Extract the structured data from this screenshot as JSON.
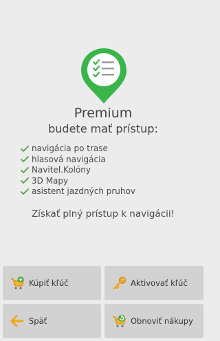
{
  "header": {
    "title": "Premium",
    "subtitle": "budete mať prístup:"
  },
  "features": [
    "navigácia po trase",
    "hlasová navigácia",
    "Navitel.Kolóny",
    "3D Mapy",
    "asistent jazdných pruhov"
  ],
  "cta_text": "Získať plný prístup k navigácii!",
  "buttons": {
    "buy_label": "Kúpiť kľúč",
    "activate_label": "Aktivovať kľúč",
    "back_label": "Späť",
    "restore_label": "Obnoviť nákupy"
  },
  "colors": {
    "accent_green": "#3ab54a",
    "check_green": "#4aa63c",
    "button_bg": "#d2d2d2",
    "background": "#ececec"
  },
  "icons": {
    "logo": "premium-checklist-pin-icon",
    "buy": "cart-add-icon",
    "activate": "key-icon",
    "back": "arrow-left-icon",
    "restore": "cart-refresh-icon"
  }
}
